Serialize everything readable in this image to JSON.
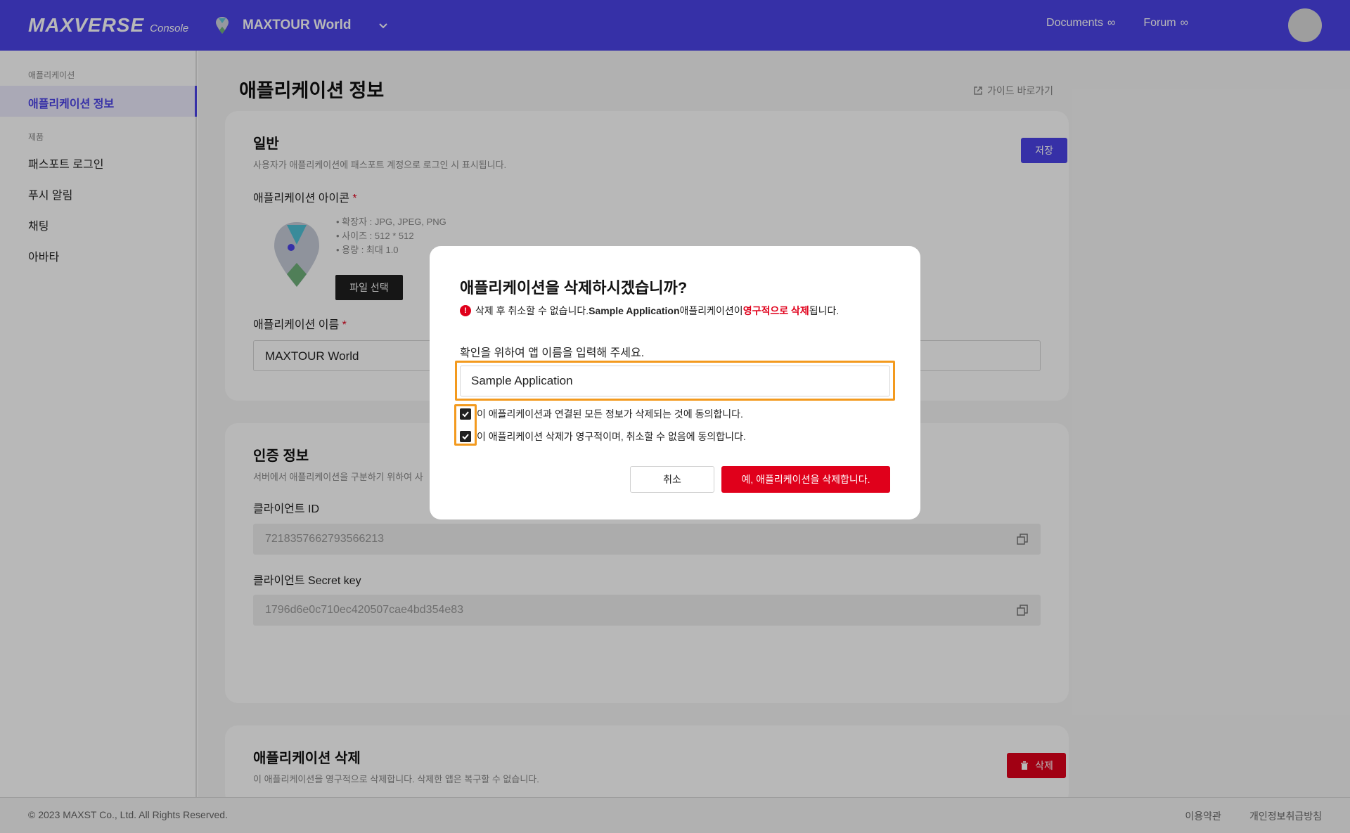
{
  "topbar": {
    "brand": "MAXVERSE",
    "brand_sub": "Console",
    "app_name": "MAXTOUR World",
    "links": [
      "Documents",
      "Forum"
    ]
  },
  "sidebar": {
    "group1": "애플리케이션",
    "active_item": "애플리케이션 정보",
    "group2": "제품",
    "items": [
      "패스포트 로그인",
      "푸시 알림",
      "채팅",
      "아바타"
    ]
  },
  "main": {
    "title": "애플리케이션 정보",
    "guide_link": "가이드 바로가기",
    "general": {
      "title": "일반",
      "subtitle": "사용자가 애플리케이션에 패스포트 계정으로 로그인 시 표시됩니다.",
      "save_label": "저장",
      "icon_label": "애플리케이션 아이콘",
      "icon_rules": [
        "확장자 : JPG, JPEG, PNG",
        "사이즈 : 512 * 512",
        "용량 : 최대 1.0"
      ],
      "file_button": "파일 선택",
      "name_label": "애플리케이션 이름",
      "name_value": "MAXTOUR World",
      "required_mark": "*"
    },
    "auth": {
      "title": "인증 정보",
      "subtitle": "서버에서 애플리케이션을 구분하기 위하여 사",
      "client_id_label": "클라이언트 ID",
      "client_id_value": "7218357662793566213",
      "secret_label": "클라이언트 Secret key",
      "secret_value": "1796d6e0c710ec420507cae4bd354e83"
    },
    "delete": {
      "title": "애플리케이션 삭제",
      "subtitle": "이 애플리케이션을 영구적으로 삭제합니다. 삭제한 앱은 복구할 수 없습니다.",
      "button": "삭제"
    }
  },
  "footer": {
    "copyright": "© 2023 MAXST Co., Ltd. All Rights Reserved.",
    "links": [
      "이용약관",
      "개인정보취급방침"
    ]
  },
  "modal": {
    "title": "애플리케이션을 삭제하시겠습니까?",
    "warn_prefix": "삭제 후 취소할 수 없습니다. ",
    "warn_app": "Sample Application",
    "warn_mid": " 애플리케이션이 ",
    "warn_red": "영구적으로 삭제",
    "warn_suffix": "됩니다.",
    "confirm_label": "확인을 위하여 앱 이름을 입력해 주세요.",
    "confirm_value": "Sample Application",
    "check1": "이 애플리케이션과 연결된 모든 정보가 삭제되는 것에 동의합니다.",
    "check2": "이 애플리케이션 삭제가 영구적이며, 취소할 수 없음에 동의합니다.",
    "cancel": "취소",
    "confirm": "예, 애플리케이션을 삭제합니다."
  }
}
